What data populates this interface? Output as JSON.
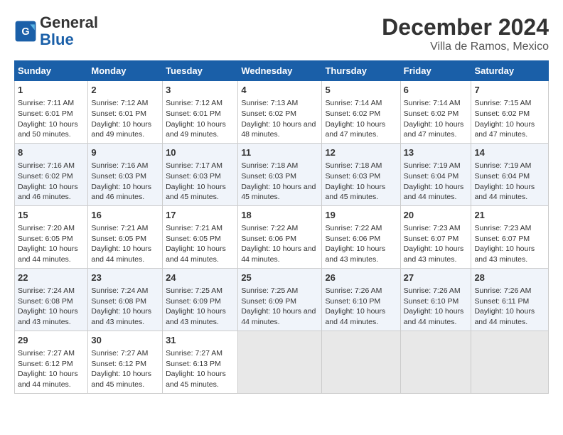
{
  "logo": {
    "text_general": "General",
    "text_blue": "Blue"
  },
  "title": "December 2024",
  "subtitle": "Villa de Ramos, Mexico",
  "days_of_week": [
    "Sunday",
    "Monday",
    "Tuesday",
    "Wednesday",
    "Thursday",
    "Friday",
    "Saturday"
  ],
  "weeks": [
    [
      {
        "day": "1",
        "sunrise": "7:11 AM",
        "sunset": "6:01 PM",
        "daylight": "10 hours and 50 minutes."
      },
      {
        "day": "2",
        "sunrise": "7:12 AM",
        "sunset": "6:01 PM",
        "daylight": "10 hours and 49 minutes."
      },
      {
        "day": "3",
        "sunrise": "7:12 AM",
        "sunset": "6:01 PM",
        "daylight": "10 hours and 49 minutes."
      },
      {
        "day": "4",
        "sunrise": "7:13 AM",
        "sunset": "6:02 PM",
        "daylight": "10 hours and 48 minutes."
      },
      {
        "day": "5",
        "sunrise": "7:14 AM",
        "sunset": "6:02 PM",
        "daylight": "10 hours and 47 minutes."
      },
      {
        "day": "6",
        "sunrise": "7:14 AM",
        "sunset": "6:02 PM",
        "daylight": "10 hours and 47 minutes."
      },
      {
        "day": "7",
        "sunrise": "7:15 AM",
        "sunset": "6:02 PM",
        "daylight": "10 hours and 47 minutes."
      }
    ],
    [
      {
        "day": "8",
        "sunrise": "7:16 AM",
        "sunset": "6:02 PM",
        "daylight": "10 hours and 46 minutes."
      },
      {
        "day": "9",
        "sunrise": "7:16 AM",
        "sunset": "6:03 PM",
        "daylight": "10 hours and 46 minutes."
      },
      {
        "day": "10",
        "sunrise": "7:17 AM",
        "sunset": "6:03 PM",
        "daylight": "10 hours and 45 minutes."
      },
      {
        "day": "11",
        "sunrise": "7:18 AM",
        "sunset": "6:03 PM",
        "daylight": "10 hours and 45 minutes."
      },
      {
        "day": "12",
        "sunrise": "7:18 AM",
        "sunset": "6:03 PM",
        "daylight": "10 hours and 45 minutes."
      },
      {
        "day": "13",
        "sunrise": "7:19 AM",
        "sunset": "6:04 PM",
        "daylight": "10 hours and 44 minutes."
      },
      {
        "day": "14",
        "sunrise": "7:19 AM",
        "sunset": "6:04 PM",
        "daylight": "10 hours and 44 minutes."
      }
    ],
    [
      {
        "day": "15",
        "sunrise": "7:20 AM",
        "sunset": "6:05 PM",
        "daylight": "10 hours and 44 minutes."
      },
      {
        "day": "16",
        "sunrise": "7:21 AM",
        "sunset": "6:05 PM",
        "daylight": "10 hours and 44 minutes."
      },
      {
        "day": "17",
        "sunrise": "7:21 AM",
        "sunset": "6:05 PM",
        "daylight": "10 hours and 44 minutes."
      },
      {
        "day": "18",
        "sunrise": "7:22 AM",
        "sunset": "6:06 PM",
        "daylight": "10 hours and 44 minutes."
      },
      {
        "day": "19",
        "sunrise": "7:22 AM",
        "sunset": "6:06 PM",
        "daylight": "10 hours and 43 minutes."
      },
      {
        "day": "20",
        "sunrise": "7:23 AM",
        "sunset": "6:07 PM",
        "daylight": "10 hours and 43 minutes."
      },
      {
        "day": "21",
        "sunrise": "7:23 AM",
        "sunset": "6:07 PM",
        "daylight": "10 hours and 43 minutes."
      }
    ],
    [
      {
        "day": "22",
        "sunrise": "7:24 AM",
        "sunset": "6:08 PM",
        "daylight": "10 hours and 43 minutes."
      },
      {
        "day": "23",
        "sunrise": "7:24 AM",
        "sunset": "6:08 PM",
        "daylight": "10 hours and 43 minutes."
      },
      {
        "day": "24",
        "sunrise": "7:25 AM",
        "sunset": "6:09 PM",
        "daylight": "10 hours and 43 minutes."
      },
      {
        "day": "25",
        "sunrise": "7:25 AM",
        "sunset": "6:09 PM",
        "daylight": "10 hours and 44 minutes."
      },
      {
        "day": "26",
        "sunrise": "7:26 AM",
        "sunset": "6:10 PM",
        "daylight": "10 hours and 44 minutes."
      },
      {
        "day": "27",
        "sunrise": "7:26 AM",
        "sunset": "6:10 PM",
        "daylight": "10 hours and 44 minutes."
      },
      {
        "day": "28",
        "sunrise": "7:26 AM",
        "sunset": "6:11 PM",
        "daylight": "10 hours and 44 minutes."
      }
    ],
    [
      {
        "day": "29",
        "sunrise": "7:27 AM",
        "sunset": "6:12 PM",
        "daylight": "10 hours and 44 minutes."
      },
      {
        "day": "30",
        "sunrise": "7:27 AM",
        "sunset": "6:12 PM",
        "daylight": "10 hours and 45 minutes."
      },
      {
        "day": "31",
        "sunrise": "7:27 AM",
        "sunset": "6:13 PM",
        "daylight": "10 hours and 45 minutes."
      },
      null,
      null,
      null,
      null
    ]
  ]
}
